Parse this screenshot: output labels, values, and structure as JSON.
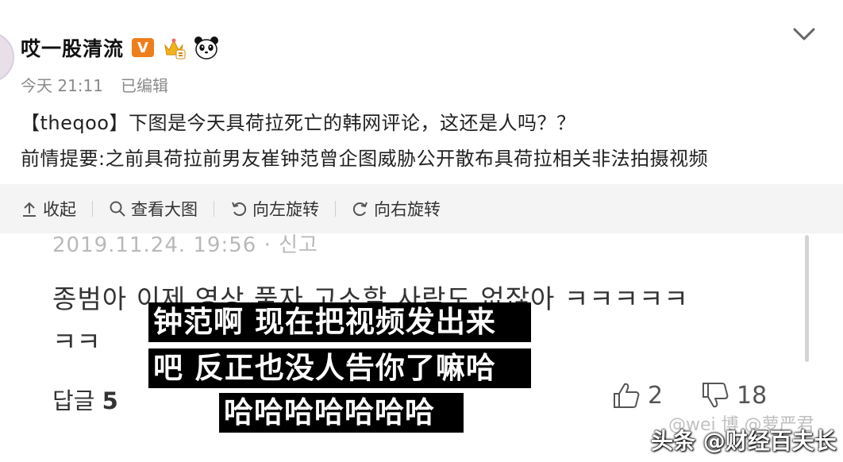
{
  "post": {
    "username": "哎一股清流",
    "vip_badge": "V",
    "time": "今天 21:11",
    "edited": "已编辑",
    "line1": "【theqoo】下图是今天具荷拉死亡的韩网评论，这还是人吗？？",
    "line2": "前情提要:之前具荷拉前男友崔钟范曾企图威胁公开散布具荷拉相关非法拍摄视频"
  },
  "toolbar": {
    "collapse": "收起",
    "view_large": "查看大图",
    "rotate_left": "向左旋转",
    "rotate_right": "向右旋转"
  },
  "image": {
    "date": "2019.11.24. 19:56 · 신고",
    "comment_line1": "종범아 이제 영상 풀자  고소할 사람도 없잖아 ㅋㅋㅋㅋㅋ",
    "comment_line2": "ㅋㅋ",
    "replies_label": "답글",
    "replies_count": "5",
    "likes": "2",
    "dislikes": "18",
    "subtitle1": "钟范啊 现在把视频发出来",
    "subtitle2": "吧 反正也没人告你了嘛哈",
    "subtitle3": "哈哈哈哈哈哈哈",
    "watermark_light": "@wei 博 @萝严君",
    "watermark": "头条 @财经百夫长"
  },
  "icons": [
    "chevron-down-icon",
    "crown-icon",
    "panda-icon",
    "collapse-icon",
    "search-icon",
    "rotate-left-icon",
    "rotate-right-icon",
    "thumb-up-icon",
    "thumb-down-icon"
  ],
  "colors": {
    "vip": "#ee7e1c",
    "toolbar_bg": "#f4f4f4",
    "meta_text": "#8a8a8a"
  }
}
